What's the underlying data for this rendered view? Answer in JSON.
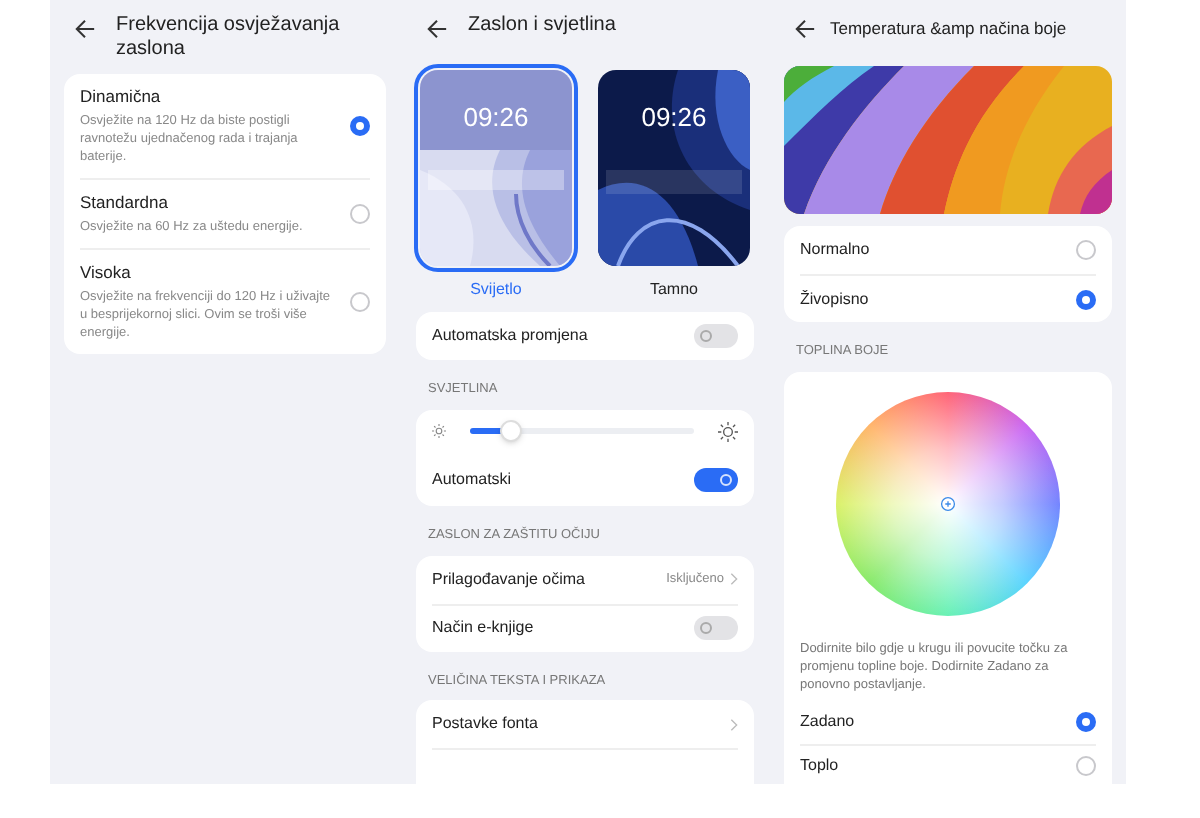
{
  "refresh_screen": {
    "title": "Frekvencija osvježavanja zaslona",
    "options": [
      {
        "label": "Dinamična",
        "description": "Osvježite na 120 Hz da biste postigli ravnotežu ujednačenog rada i trajanja baterije.",
        "selected": true
      },
      {
        "label": "Standardna",
        "description": "Osvježite na 60 Hz za uštedu energije.",
        "selected": false
      },
      {
        "label": "Visoka",
        "description": "Osvježite na frekvenciji do 120 Hz i uživajte u besprijekornoj slici. Ovim se troši više energije.",
        "selected": false
      }
    ]
  },
  "display_screen": {
    "title": "Zaslon i svjetlina",
    "themes": [
      {
        "label": "Svijetlo",
        "time": "09:26",
        "kind": "light",
        "selected": true
      },
      {
        "label": "Tamno",
        "time": "09:26",
        "kind": "dark",
        "selected": false
      }
    ],
    "auto_switch": {
      "label": "Automatska promjena",
      "on": false
    },
    "brightness": {
      "header": "SVJETLINA",
      "level": 0.18,
      "auto_label": "Automatski",
      "auto_on": true
    },
    "eye_section": {
      "header": "ZASLON ZA ZAŠTITU OČIJU",
      "rows": [
        {
          "kind": "link",
          "label": "Prilagođavanje očima",
          "value": "Isključeno"
        },
        {
          "kind": "toggle",
          "label": "Način e-knjige",
          "on": false
        }
      ]
    },
    "text_section": {
      "header": "VELIČINA TEKSTA I PRIKAZA",
      "rows": [
        {
          "kind": "link",
          "label": "Postavke fonta"
        }
      ]
    }
  },
  "color_screen": {
    "title": "Temperatura &amp načina boje",
    "modes": [
      {
        "label": "Normalno",
        "selected": false
      },
      {
        "label": "Živopisno",
        "selected": true
      }
    ],
    "temperature_header": "TOPLINA BOJE",
    "hint": "Dodirnite bilo gdje u krugu ili povucite točku za promjenu topline boje. Dodirnite Zadano za ponovno postavljanje.",
    "presets": [
      {
        "label": "Zadano",
        "selected": true
      },
      {
        "label": "Toplo",
        "selected": false
      }
    ]
  }
}
